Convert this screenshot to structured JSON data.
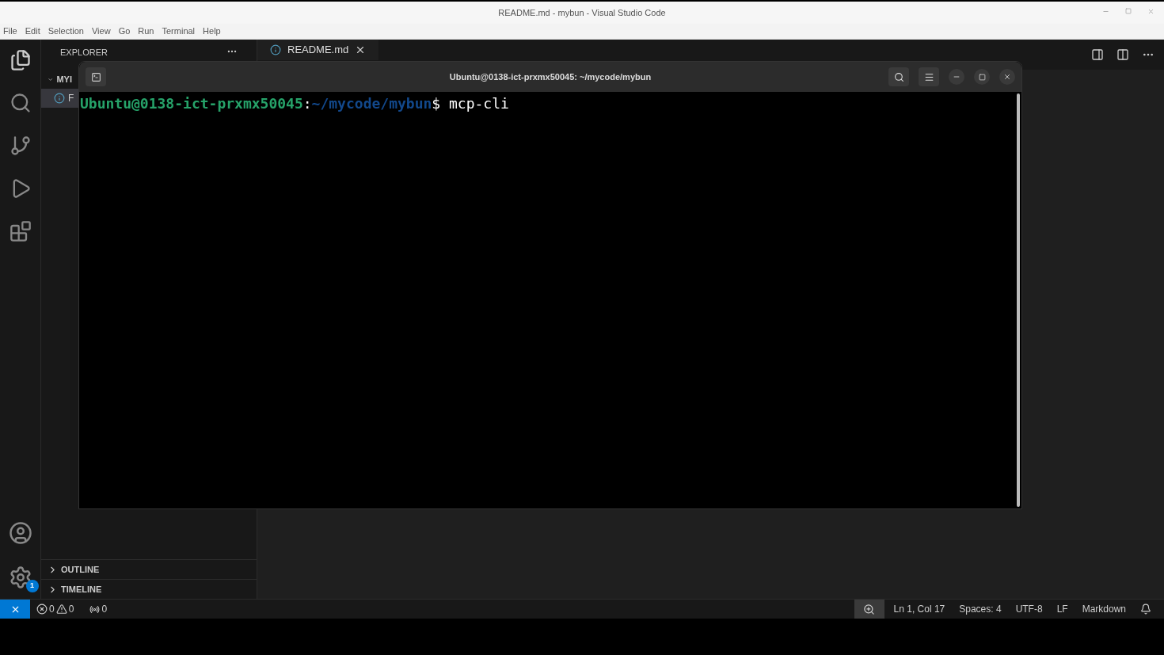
{
  "window": {
    "title": "README.md - mybun - Visual Studio Code"
  },
  "menu": [
    "File",
    "Edit",
    "Selection",
    "View",
    "Go",
    "Run",
    "Terminal",
    "Help"
  ],
  "sidebar": {
    "title": "EXPLORER",
    "folder": {
      "label": "MYI",
      "expanded": true
    },
    "file": "F",
    "sections": [
      {
        "label": "OUTLINE",
        "expanded": false
      },
      {
        "label": "TIMELINE",
        "expanded": false
      }
    ]
  },
  "settings_badge": "1",
  "editor_tab": {
    "label": "README.md"
  },
  "terminal": {
    "title": "Ubuntu@0138-ict-prxmx50045: ~/mycode/mybun",
    "user_host": "Ubuntu@0138-ict-prxmx50045",
    "separator": ":",
    "path": "~/mycode/mybun",
    "prompt": "$",
    "command": "mcp-cli"
  },
  "status_bar": {
    "errors": "0",
    "warnings": "0",
    "ports": "0",
    "right": [
      "Ln 1, Col 17",
      "Spaces: 4",
      "UTF-8",
      "LF",
      "Markdown"
    ]
  }
}
